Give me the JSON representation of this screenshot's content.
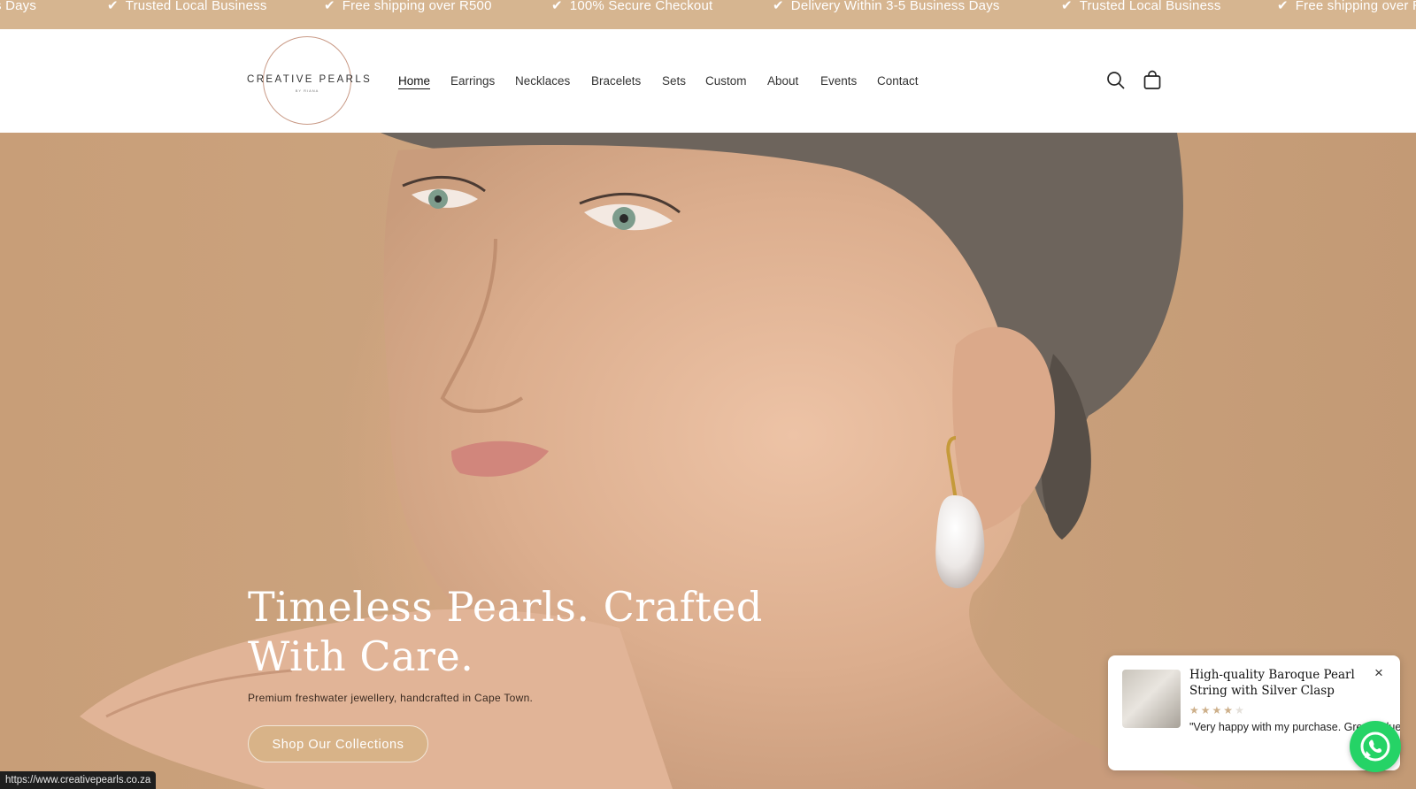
{
  "announcement": {
    "check_glyph": "✔",
    "items": [
      {
        "text": "s Days",
        "check": false
      },
      {
        "text": "Trusted Local Business",
        "check": true
      },
      {
        "text": "Free shipping over R500",
        "check": true
      },
      {
        "text": "100% Secure Checkout",
        "check": true
      },
      {
        "text": "Delivery Within 3-5 Business Days",
        "check": true
      },
      {
        "text": "Trusted Local Business",
        "check": true
      },
      {
        "text": "Free shipping over R",
        "check": true
      }
    ]
  },
  "header": {
    "logo_main": "CREATIVE PEARLS",
    "logo_sub": "BY RIANA",
    "nav": [
      {
        "label": "Home",
        "active": true
      },
      {
        "label": "Earrings",
        "active": false
      },
      {
        "label": "Necklaces",
        "active": false
      },
      {
        "label": "Bracelets",
        "active": false
      },
      {
        "label": "Sets",
        "active": false
      },
      {
        "label": "Custom",
        "active": false
      },
      {
        "label": "About",
        "active": false
      },
      {
        "label": "Events",
        "active": false
      },
      {
        "label": "Contact",
        "active": false
      }
    ],
    "icons": [
      "search-icon",
      "cart-icon"
    ]
  },
  "hero": {
    "title": "Timeless Pearls. Crafted With Care.",
    "subtitle": "Premium freshwater jewellery, handcrafted in Cape Town.",
    "cta_label": "Shop Our Collections"
  },
  "review_popup": {
    "product_title": "High-quality Baroque Pearl String with Silver Clasp",
    "rating": 4,
    "rating_max": 5,
    "quote": "\"Very happy with my purchase. Great value!\"",
    "close_glyph": "×"
  },
  "whatsapp": {
    "icon": "whatsapp-icon"
  },
  "status_bar": {
    "url": "https://www.creativepearls.co.za"
  },
  "colors": {
    "announcement_bg": "#d6b590",
    "hero_bg": "#c89e78",
    "cta_bg": "#d8b388",
    "whatsapp": "#25d366"
  }
}
